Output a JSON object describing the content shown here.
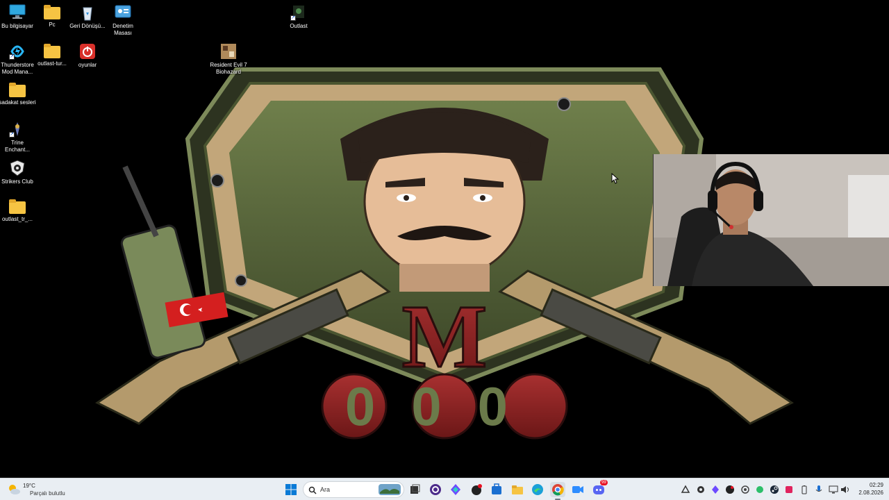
{
  "desktop": {
    "icons": [
      {
        "label": "Bu bilgisayar",
        "icon": "monitor-icon"
      },
      {
        "label": "Pc",
        "icon": "folder-icon"
      },
      {
        "label": "Geri Dönüşü...",
        "icon": "recycle-bin-icon"
      },
      {
        "label": "Denetim Masası",
        "icon": "control-panel-icon"
      },
      {
        "label": "Outlast",
        "icon": "game-shortcut-icon"
      },
      {
        "label": "Thunderstore Mod Mana...",
        "icon": "thunderstore-icon"
      },
      {
        "label": "outlast-tur...",
        "icon": "folder-icon"
      },
      {
        "label": "oyunlar",
        "icon": "power-app-icon"
      },
      {
        "label": "Resident Evil 7 Biohazard",
        "icon": "resident-evil-icon"
      },
      {
        "label": "sadakat sesleri",
        "icon": "folder-icon"
      },
      {
        "label": "Trine Enchant...",
        "icon": "trine-icon"
      },
      {
        "label": "Strikers Club",
        "icon": "strikers-club-icon"
      },
      {
        "label": "outlast_tr_...",
        "icon": "folder-icon"
      }
    ]
  },
  "wallpaper": {
    "letter": "M",
    "digits": "000",
    "accent": "#8a2424",
    "shield": "#5a6b3e"
  },
  "taskbar": {
    "weather": {
      "temp": "19°C",
      "condition": "Parçalı bulutlu",
      "icon": "partly-cloudy-icon"
    },
    "search_placeholder": "Ara",
    "apps": [
      "start-icon",
      "task-view-icon",
      "browser-app-icon",
      "proton-vpn-icon",
      "game-app-icon",
      "store-icon",
      "file-explorer-icon",
      "edge-icon",
      "chrome-icon",
      "video-call-icon",
      "discord-icon"
    ],
    "discord_badge": "99",
    "tray": [
      "copilot-icon",
      "app-tray-icon",
      "proton-tray-icon",
      "game-tray-icon",
      "sync-icon",
      "green-status-icon",
      "steam-icon",
      "red-app-icon",
      "battery-icon",
      "mic-icon",
      "display-icon",
      "speaker-icon"
    ],
    "time": "02:29",
    "date": "2.08.2026"
  }
}
